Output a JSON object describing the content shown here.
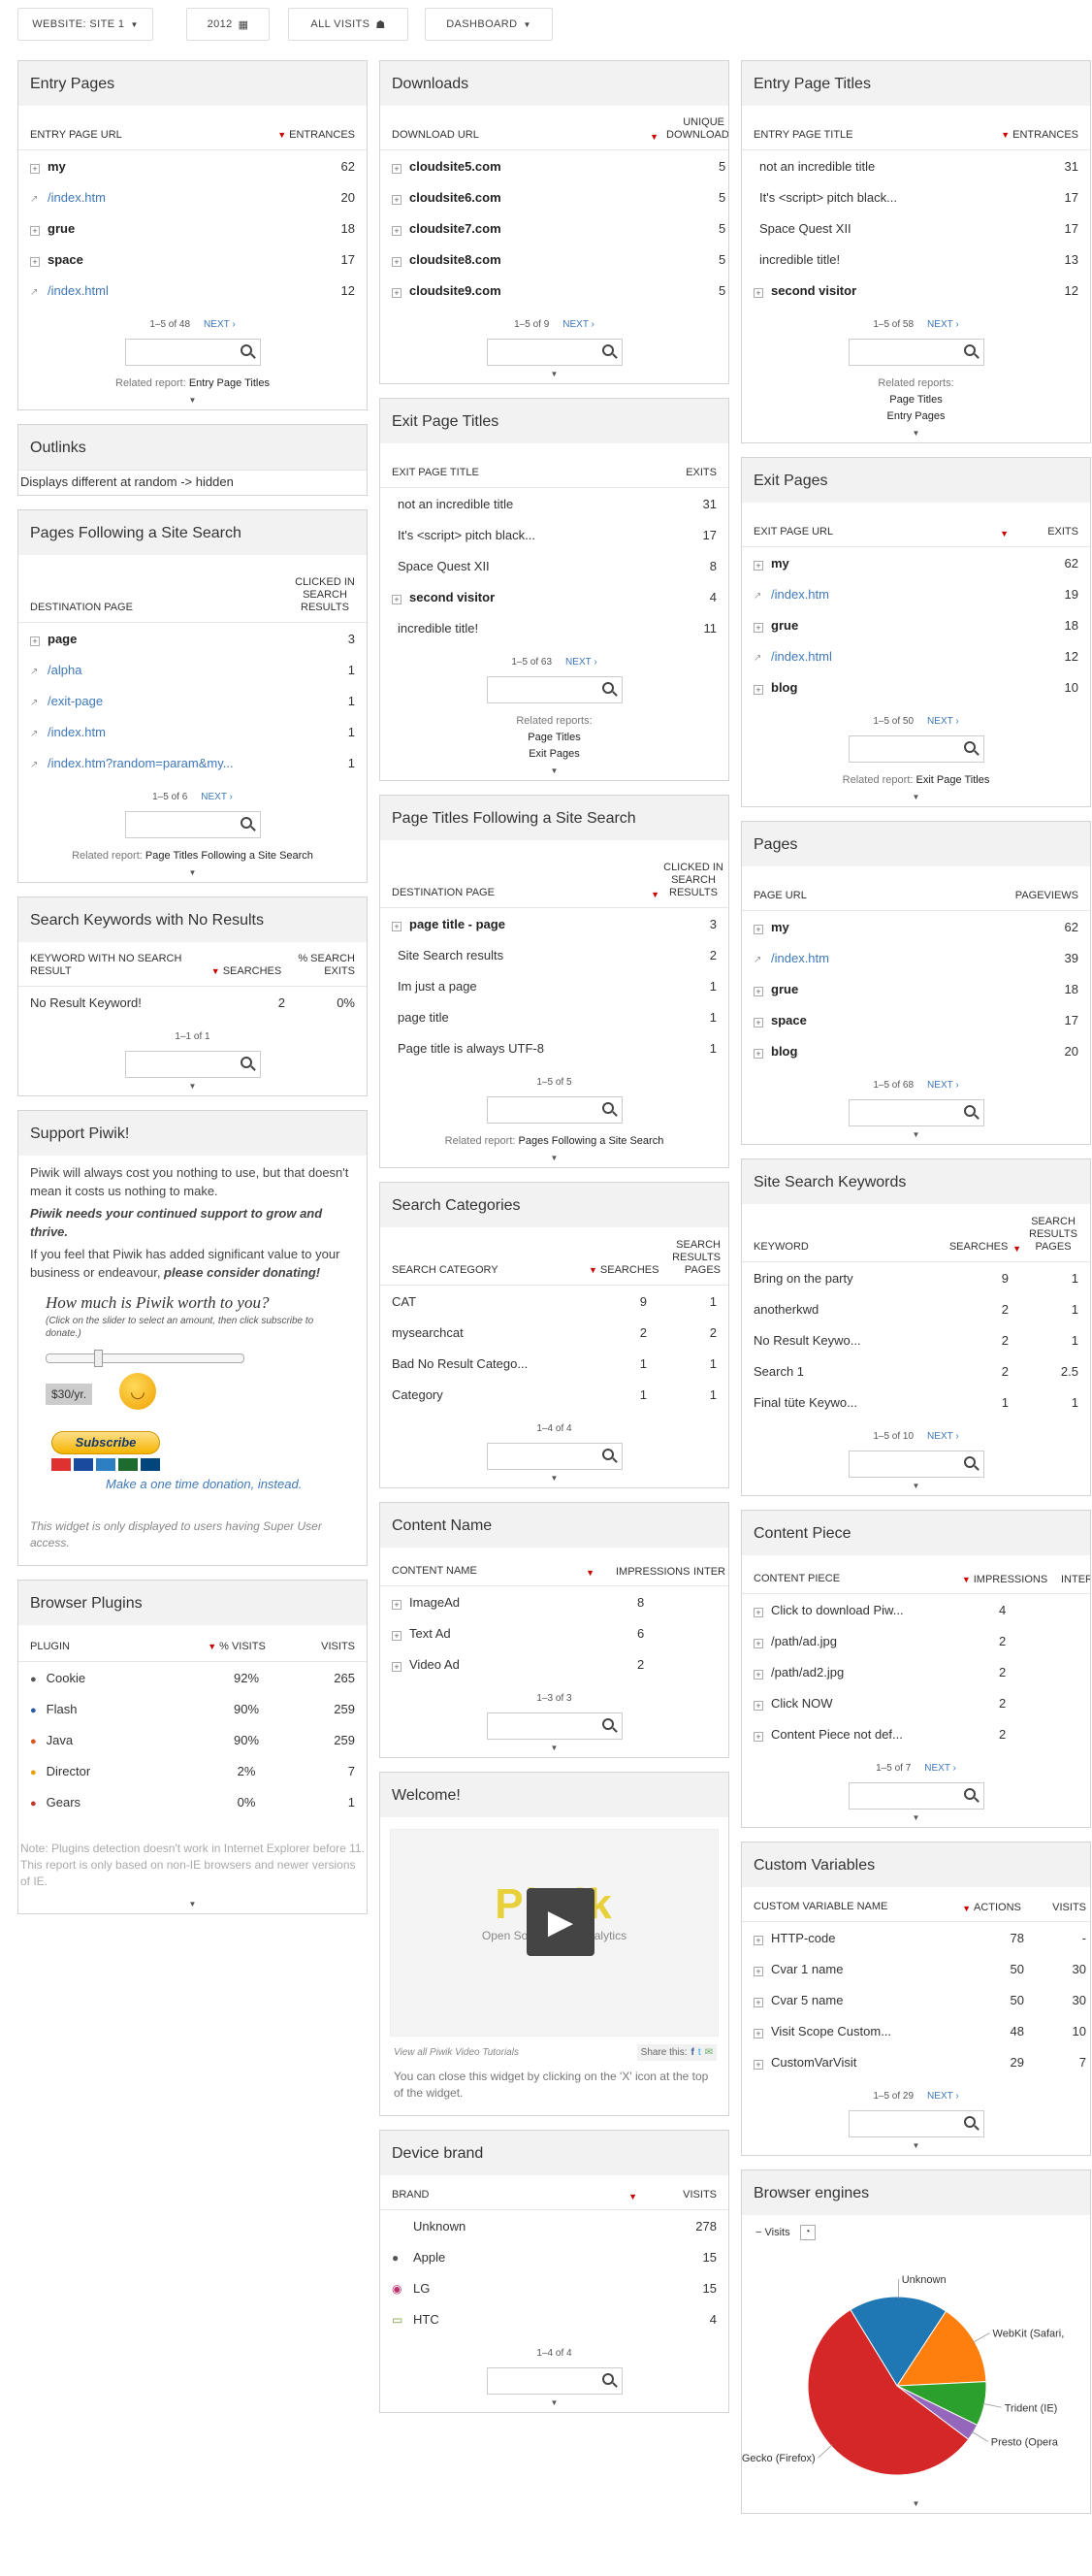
{
  "topbar": {
    "website": "WEBSITE: SITE 1",
    "year": "2012",
    "segment": "ALL VISITS",
    "dashboard": "DASHBOARD"
  },
  "entry_pages": {
    "title": "Entry Pages",
    "col1": "ENTRY PAGE URL",
    "col2": "ENTRANCES",
    "rows": [
      {
        "label": "my",
        "value": "62",
        "kind": "folder"
      },
      {
        "label": "/index.htm",
        "value": "20",
        "kind": "link"
      },
      {
        "label": "grue",
        "value": "18",
        "kind": "folder"
      },
      {
        "label": "space",
        "value": "17",
        "kind": "folder"
      },
      {
        "label": "/index.html",
        "value": "12",
        "kind": "link"
      }
    ],
    "pagination": "1–5 of 48",
    "next": "NEXT ›",
    "related_prefix": "Related report:",
    "related": "Entry Page Titles"
  },
  "outlinks": {
    "title": "Outlinks",
    "text": "Displays different at random -> hidden"
  },
  "pfss": {
    "title": "Pages Following a Site Search",
    "col1": "DESTINATION PAGE",
    "col2": "CLICKED IN SEARCH RESULTS",
    "rows": [
      {
        "label": "page",
        "value": "3",
        "kind": "folder"
      },
      {
        "label": "/alpha",
        "value": "1",
        "kind": "link"
      },
      {
        "label": "/exit-page",
        "value": "1",
        "kind": "link"
      },
      {
        "label": "/index.htm",
        "value": "1",
        "kind": "link"
      },
      {
        "label": "/index.htm?random=param&my...",
        "value": "1",
        "kind": "link"
      }
    ],
    "pagination": "1–5 of 6",
    "next": "NEXT ›",
    "related_prefix": "Related report:",
    "related": "Page Titles Following a Site Search"
  },
  "noresult": {
    "title": "Search Keywords with No Results",
    "col1": "KEYWORD WITH NO SEARCH RESULT",
    "col2": "SEARCHES",
    "col3": "% SEARCH EXITS",
    "rows": [
      {
        "label": "No Result Keyword!",
        "v1": "2",
        "v2": "0%"
      }
    ],
    "pagination": "1–1 of 1"
  },
  "support": {
    "title": "Support Piwik!",
    "p1": "Piwik will always cost you nothing to use, but that doesn't mean it costs us nothing to make.",
    "p2": "Piwik needs your continued support to grow and thrive.",
    "p3a": "If you feel that Piwik has added significant value to your business or endeavour, ",
    "p3b": "please consider donating!",
    "q": "How much is Piwik worth to you?",
    "hint": "(Click on the slider to select an amount, then click subscribe to donate.)",
    "price": "$30/yr.",
    "slider_fraction": 0.25,
    "subscribe": "Subscribe",
    "onetime": "Make a one time donation, instead.",
    "note": "This widget is only displayed to users having Super User access."
  },
  "plugins": {
    "title": "Browser Plugins",
    "col1": "PLUGIN",
    "col2": "% VISITS",
    "col3": "VISITS",
    "rows": [
      {
        "label": "Cookie",
        "v1": "92%",
        "v2": "265",
        "color": "#555"
      },
      {
        "label": "Flash",
        "v1": "90%",
        "v2": "259",
        "color": "#2a5aa0"
      },
      {
        "label": "Java",
        "v1": "90%",
        "v2": "259",
        "color": "#d9541e"
      },
      {
        "label": "Director",
        "v1": "2%",
        "v2": "7",
        "color": "#e8a000"
      },
      {
        "label": "Gears",
        "v1": "0%",
        "v2": "1",
        "color": "#c0392b"
      }
    ],
    "note": "Note: Plugins detection doesn't work in Internet Explorer before 11. This report is only based on non-IE browsers and newer versions of IE."
  },
  "downloads": {
    "title": "Downloads",
    "col1": "DOWNLOAD URL",
    "col2": "UNIQUE DOWNLOADS",
    "rows": [
      {
        "label": "cloudsite5.com",
        "value": "5"
      },
      {
        "label": "cloudsite6.com",
        "value": "5"
      },
      {
        "label": "cloudsite7.com",
        "value": "5"
      },
      {
        "label": "cloudsite8.com",
        "value": "5"
      },
      {
        "label": "cloudsite9.com",
        "value": "5"
      }
    ],
    "pagination": "1–5 of 9",
    "next": "NEXT ›"
  },
  "exit_titles": {
    "title": "Exit Page Titles",
    "col1": "EXIT PAGE TITLE",
    "col2": "EXITS",
    "rows": [
      {
        "label": "not an incredible title",
        "value": "31",
        "kind": "plain"
      },
      {
        "label": "It's <script> pitch black...",
        "value": "17",
        "kind": "plain"
      },
      {
        "label": "Space Quest XII",
        "value": "8",
        "kind": "plain"
      },
      {
        "label": "second visitor",
        "value": "4",
        "kind": "folder"
      },
      {
        "label": "incredible title!",
        "value": "11",
        "kind": "plain"
      }
    ],
    "pagination": "1–5 of 63",
    "next": "NEXT ›",
    "related_prefix": "Related reports:",
    "related1": "Page Titles",
    "related2": "Exit Pages"
  },
  "ptfss": {
    "title": "Page Titles Following a Site Search",
    "col1": "DESTINATION PAGE",
    "col2": "CLICKED IN SEARCH RESULTS",
    "rows": [
      {
        "label": "page title - page",
        "value": "3",
        "kind": "folder"
      },
      {
        "label": "Site Search results",
        "value": "2",
        "kind": "plain"
      },
      {
        "label": "Im just a page",
        "value": "1",
        "kind": "plain"
      },
      {
        "label": "page title",
        "value": "1",
        "kind": "plain"
      },
      {
        "label": "Page title is always UTF-8",
        "value": "1",
        "kind": "plain"
      }
    ],
    "pagination": "1–5 of 5",
    "related_prefix": "Related report:",
    "related": "Pages Following a Site Search"
  },
  "categories": {
    "title": "Search Categories",
    "col1": "SEARCH CATEGORY",
    "col2": "SEARCHES",
    "col3": "SEARCH RESULTS PAGES",
    "rows": [
      {
        "label": "CAT",
        "v1": "9",
        "v2": "1"
      },
      {
        "label": "mysearchcat",
        "v1": "2",
        "v2": "2"
      },
      {
        "label": "Bad No Result Catego...",
        "v1": "1",
        "v2": "1"
      },
      {
        "label": "Category",
        "v1": "1",
        "v2": "1"
      }
    ],
    "pagination": "1–4 of 4"
  },
  "content_name": {
    "title": "Content Name",
    "col1": "CONTENT NAME",
    "col2": "IMPRESSIONS",
    "col3": "INTER",
    "rows": [
      {
        "label": "ImageAd",
        "value": "8"
      },
      {
        "label": "Text Ad",
        "value": "6"
      },
      {
        "label": "Video Ad",
        "value": "2"
      }
    ],
    "pagination": "1–3 of 3"
  },
  "welcome": {
    "title": "Welcome!",
    "logo_text": "Piwik",
    "logo_sub": "Open Source Web Analytics",
    "tutorials": "View all Piwik Video Tutorials",
    "share": "Share this:",
    "close_text": "You can close this widget by clicking on the 'X' icon at the top of the widget."
  },
  "device_brand": {
    "title": "Device brand",
    "col1": "BRAND",
    "col2": "VISITS",
    "rows": [
      {
        "label": "Unknown",
        "value": "278"
      },
      {
        "label": "Apple",
        "value": "15"
      },
      {
        "label": "LG",
        "value": "15"
      },
      {
        "label": "HTC",
        "value": "4"
      }
    ],
    "pagination": "1–4 of 4"
  },
  "entry_titles": {
    "title": "Entry Page Titles",
    "col1": "ENTRY PAGE TITLE",
    "col2": "ENTRANCES",
    "rows": [
      {
        "label": "not an incredible title",
        "value": "31",
        "kind": "plain"
      },
      {
        "label": "It's <script> pitch black...",
        "value": "17",
        "kind": "plain"
      },
      {
        "label": "Space Quest XII",
        "value": "17",
        "kind": "plain"
      },
      {
        "label": "incredible title!",
        "value": "13",
        "kind": "plain"
      },
      {
        "label": "second visitor",
        "value": "12",
        "kind": "folder"
      }
    ],
    "pagination": "1–5 of 58",
    "next": "NEXT ›",
    "related_prefix": "Related reports:",
    "related1": "Page Titles",
    "related2": "Entry Pages"
  },
  "exit_pages": {
    "title": "Exit Pages",
    "col1": "EXIT PAGE URL",
    "col2": "EXITS",
    "rows": [
      {
        "label": "my",
        "value": "62",
        "kind": "folder"
      },
      {
        "label": "/index.htm",
        "value": "19",
        "kind": "link"
      },
      {
        "label": "grue",
        "value": "18",
        "kind": "folder"
      },
      {
        "label": "/index.html",
        "value": "12",
        "kind": "link"
      },
      {
        "label": "blog",
        "value": "10",
        "kind": "folder"
      }
    ],
    "pagination": "1–5 of 50",
    "next": "NEXT ›",
    "related_prefix": "Related report:",
    "related": "Exit Page Titles"
  },
  "pages": {
    "title": "Pages",
    "col1": "PAGE URL",
    "col2": "PAGEVIEWS",
    "rows": [
      {
        "label": "my",
        "value": "62",
        "kind": "folder"
      },
      {
        "label": "/index.htm",
        "value": "39",
        "kind": "link"
      },
      {
        "label": "grue",
        "value": "18",
        "kind": "folder"
      },
      {
        "label": "space",
        "value": "17",
        "kind": "folder"
      },
      {
        "label": "blog",
        "value": "20",
        "kind": "folder"
      }
    ],
    "pagination": "1–5 of 68",
    "next": "NEXT ›"
  },
  "ss_keywords": {
    "title": "Site Search Keywords",
    "col1": "KEYWORD",
    "col2": "SEARCHES",
    "col3": "SEARCH RESULTS PAGES",
    "rows": [
      {
        "label": "Bring on the party",
        "v1": "9",
        "v2": "1"
      },
      {
        "label": "anotherkwd",
        "v1": "2",
        "v2": "1"
      },
      {
        "label": "No Result Keywo...",
        "v1": "2",
        "v2": "1"
      },
      {
        "label": "Search 1",
        "v1": "2",
        "v2": "2.5"
      },
      {
        "label": "Final tüte Keywo...",
        "v1": "1",
        "v2": "1"
      }
    ],
    "pagination": "1–5 of 10",
    "next": "NEXT ›"
  },
  "content_piece": {
    "title": "Content Piece",
    "col1": "CONTENT PIECE",
    "col2": "IMPRESSIONS",
    "col3": "INTER",
    "rows": [
      {
        "label": "Click to download Piw...",
        "value": "4"
      },
      {
        "label": "/path/ad.jpg",
        "value": "2"
      },
      {
        "label": "/path/ad2.jpg",
        "value": "2"
      },
      {
        "label": "Click NOW",
        "value": "2"
      },
      {
        "label": "Content Piece not def...",
        "value": "2"
      }
    ],
    "pagination": "1–5 of 7",
    "next": "NEXT ›"
  },
  "custom_vars": {
    "title": "Custom Variables",
    "col1": "CUSTOM VARIABLE NAME",
    "col2": "ACTIONS",
    "col3": "VISITS",
    "rows": [
      {
        "label": "HTTP-code",
        "v1": "78",
        "v2": "-"
      },
      {
        "label": "Cvar 1 name",
        "v1": "50",
        "v2": "30"
      },
      {
        "label": "Cvar 5 name",
        "v1": "50",
        "v2": "30"
      },
      {
        "label": "Visit Scope Custom...",
        "v1": "48",
        "v2": "10"
      },
      {
        "label": "CustomVarVisit",
        "v1": "29",
        "v2": "7"
      }
    ],
    "pagination": "1–5 of 29",
    "next": "NEXT ›"
  },
  "engines": {
    "title": "Browser engines",
    "metric": "Visits"
  },
  "chart_data": {
    "type": "pie",
    "categories": [
      "Unknown",
      "WebKit (Safari,",
      "Trident (IE)",
      "Presto (Opera",
      "Gecko (Firefox)"
    ],
    "values": [
      18,
      15,
      8,
      3,
      56
    ],
    "colors": [
      "#1f77b4",
      "#ff7f0e",
      "#2ca02c",
      "#9467bd",
      "#d62728"
    ]
  }
}
